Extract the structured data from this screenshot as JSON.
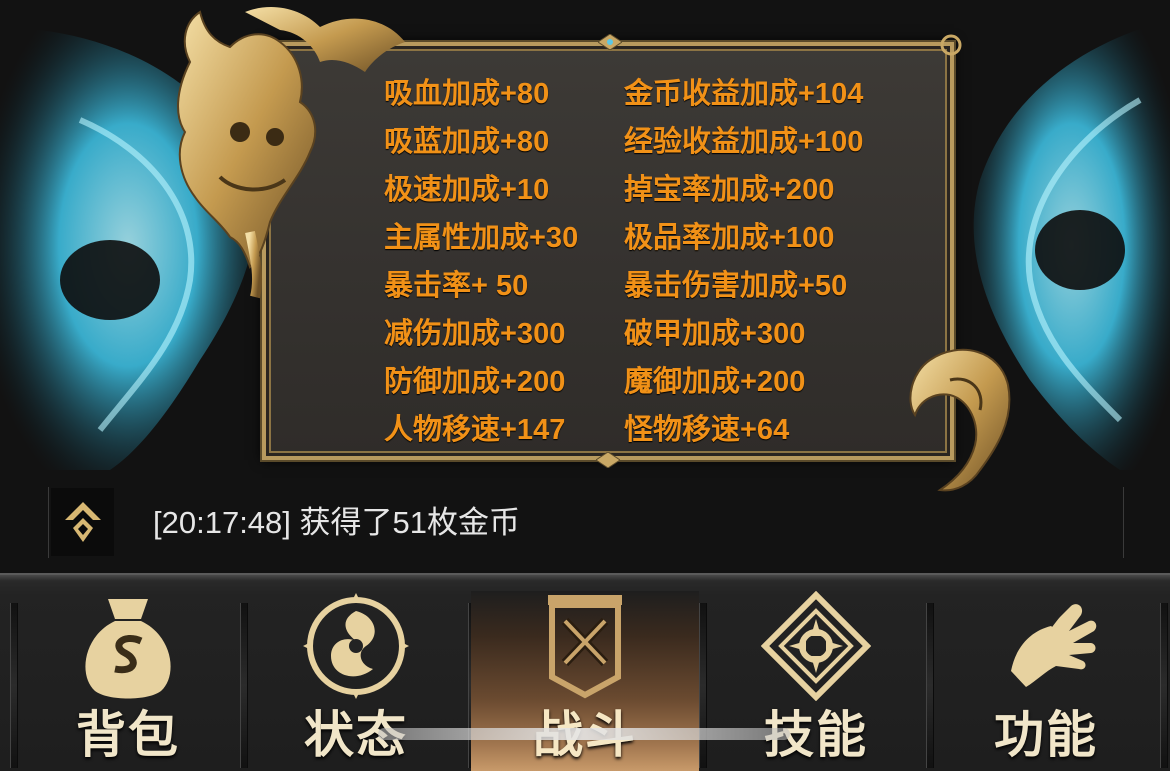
{
  "stats_panel": {
    "left_column": [
      "吸血加成+80",
      "吸蓝加成+80",
      "极速加成+10",
      "主属性加成+30",
      "暴击率+ 50",
      "减伤加成+300",
      "防御加成+200",
      "人物移速+147"
    ],
    "right_column": [
      "金币收益加成+104",
      "经验收益加成+100",
      "掉宝率加成+200",
      "极品率加成+100",
      "暴击伤害加成+50",
      "破甲加成+300",
      "魔御加成+200",
      "怪物移速+64"
    ],
    "text_color": "#f19117"
  },
  "chat": {
    "icon": "chat-channel-icon",
    "message": "[20:17:48] 获得了51枚金币"
  },
  "nav": {
    "items": [
      {
        "label": "背包",
        "icon": "money-bag-icon",
        "active": false
      },
      {
        "label": "状态",
        "icon": "swirl-emblem-icon",
        "active": false
      },
      {
        "label": "战斗",
        "icon": "crossed-swords-banner-icon",
        "active": true
      },
      {
        "label": "技能",
        "icon": "skill-diamond-icon",
        "active": false
      },
      {
        "label": "功能",
        "icon": "hand-icon",
        "active": false
      }
    ]
  },
  "colors": {
    "gold": "#d8b873",
    "flame_blue": "#4fd3f0",
    "background": "#121212"
  }
}
